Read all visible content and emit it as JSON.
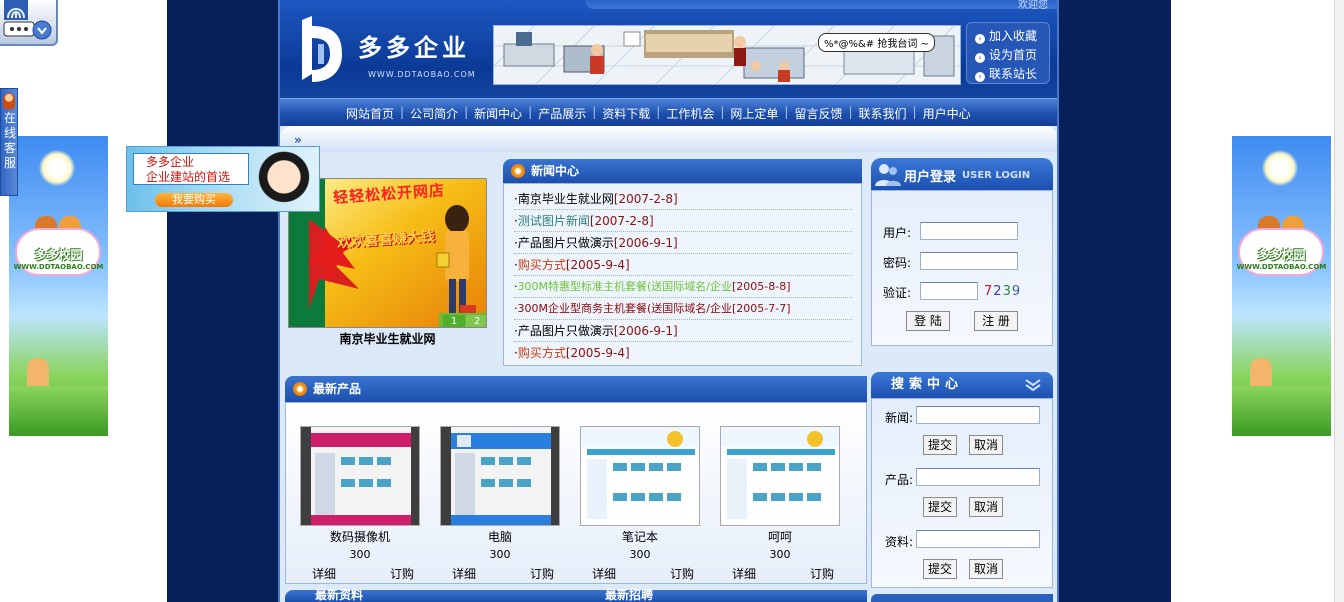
{
  "header": {
    "welcome_text": "欢迎您",
    "logo_name": "多多企业",
    "logo_url": "WWW.DDTAOBAO.COM",
    "banner_speech": "%*@%&# 抢我台词 ~",
    "quick_links": [
      "加入收藏",
      "设为首页",
      "联系站长"
    ]
  },
  "nav": {
    "items": [
      "网站首页",
      "公司简介",
      "新闻中心",
      "产品展示",
      "资料下载",
      "工作机会",
      "网上定单",
      "留言反馈",
      "联系我们",
      "用户中心"
    ]
  },
  "content": {
    "breadcrumb_arrows": "»",
    "flash": {
      "line1": "轻轻松松开网店",
      "line2": "欢欢喜喜赚大钱",
      "pages": [
        "1",
        "2"
      ],
      "caption": "南京毕业生就业网"
    }
  },
  "news": {
    "title": "新闻中心",
    "items": [
      {
        "title": "南京毕业生就业网",
        "date": "[2007-2-8]",
        "color": "#000000"
      },
      {
        "title": "测试图片新闻",
        "date": "[2007-2-8]",
        "color": "#2f7d7d"
      },
      {
        "title": "产品图片只做演示",
        "date": "[2006-9-1]",
        "color": "#000000"
      },
      {
        "title": "购买方式",
        "date": "[2005-9-4]",
        "color": "#c83c14"
      },
      {
        "title": "300M特惠型标准主机套餐(送国际域名/企业",
        "date": "[2005-8-8]",
        "color": "#6fc43a"
      },
      {
        "title": "300M企业型商务主机套餐(送国际域名/企业",
        "date": "[2005-7-7]",
        "color": "#8a0a0a"
      },
      {
        "title": "产品图片只做演示",
        "date": "[2006-9-1]",
        "color": "#000000"
      },
      {
        "title": "购买方式",
        "date": "[2005-9-4]",
        "color": "#c83c14"
      }
    ]
  },
  "login": {
    "title": "用户登录",
    "subtitle": "USER LOGIN",
    "user_label": "用户:",
    "password_label": "密码:",
    "captcha_label": "验证:",
    "captcha_digits": [
      "7",
      "2",
      "3",
      "9"
    ],
    "login_button": "登 陆",
    "register_button": "注 册"
  },
  "search": {
    "title": "搜索中心",
    "groups": [
      {
        "label": "新闻:",
        "submit": "提交",
        "cancel": "取消"
      },
      {
        "label": "产品:",
        "submit": "提交",
        "cancel": "取消"
      },
      {
        "label": "资料:",
        "submit": "提交",
        "cancel": "取消"
      }
    ]
  },
  "products": {
    "title": "最新产品",
    "items": [
      {
        "name": "数码摄像机",
        "price": "300",
        "detail": "详细",
        "order": "订购",
        "accent": "#d01f6a"
      },
      {
        "name": "电脑",
        "price": "300",
        "detail": "详细",
        "order": "订购",
        "accent": "#1f6fd0"
      },
      {
        "name": "笔记本",
        "price": "300",
        "detail": "详细",
        "order": "订购",
        "accent": "#e2b11d"
      },
      {
        "name": "呵呵",
        "price": "300",
        "detail": "详细",
        "order": "订购",
        "accent": "#e2b11d"
      }
    ]
  },
  "bottom": {
    "left_title": "最新资料",
    "right_title": "最新招聘"
  },
  "side_ads": {
    "title": "多多校园",
    "url": "WWW.DDTAOBAO.COM"
  },
  "online_service": {
    "chars": [
      "在",
      "线",
      "客",
      "服"
    ]
  },
  "buy_ad": {
    "line1": "多多企业",
    "line2": "企业建站的首选",
    "button": "我要购买"
  }
}
